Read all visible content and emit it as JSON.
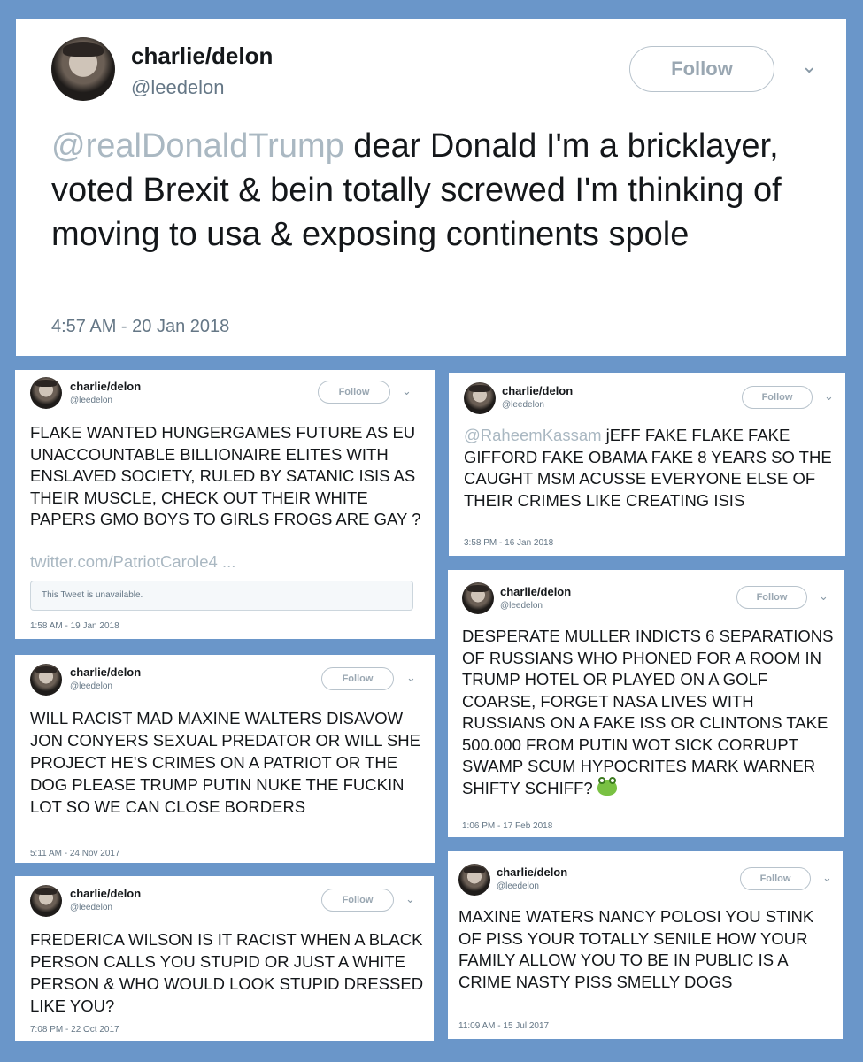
{
  "tweets": [
    {
      "user": {
        "name": "charlie/delon",
        "handle": "@leedelon"
      },
      "follow_label": "Follow",
      "mention": "@realDonaldTrump",
      "text": " dear Donald I'm a bricklayer, voted Brexit & bein totally screwed I'm thinking of moving to usa & exposing continents spole",
      "time": "4:57 AM - 20 Jan 2018"
    },
    {
      "user": {
        "name": "charlie/delon",
        "handle": "@leedelon"
      },
      "follow_label": "Follow",
      "text": "FLAKE WANTED HUNGERGAMES FUTURE AS EU UNACCOUNTABLE BILLIONAIRE ELITES WITH ENSLAVED SOCIETY, RULED BY SATANIC ISIS AS THEIR MUSCLE, CHECK OUT THEIR WHITE PAPERS GMO BOYS TO GIRLS FROGS ARE GAY ?",
      "link": "twitter.com/PatriotCarole4 ...",
      "unavailable": "This Tweet is unavailable.",
      "time": "1:58 AM - 19 Jan 2018"
    },
    {
      "user": {
        "name": "charlie/delon",
        "handle": "@leedelon"
      },
      "follow_label": "Follow",
      "mention": "@RaheemKassam",
      "text": " jEFF FAKE FLAKE FAKE GIFFORD FAKE OBAMA FAKE 8 YEARS SO THE CAUGHT MSM ACUSSE EVERYONE ELSE OF THEIR CRIMES LIKE CREATING ISIS",
      "time": "3:58 PM - 16 Jan 2018"
    },
    {
      "user": {
        "name": "charlie/delon",
        "handle": "@leedelon"
      },
      "follow_label": "Follow",
      "text": "DESPERATE MULLER INDICTS 6 SEPARATIONS OF RUSSIANS WHO PHONED FOR A ROOM IN TRUMP HOTEL OR PLAYED ON A GOLF COARSE, FORGET NASA LIVES WITH RUSSIANS ON A FAKE ISS OR CLINTONS TAKE 500.000 FROM PUTIN WOT SICK CORRUPT SWAMP SCUM HYPOCRITES MARK WARNER SHIFTY SCHIFF?",
      "emoji": "frog-emoji",
      "time": "1:06 PM - 17 Feb 2018"
    },
    {
      "user": {
        "name": "charlie/delon",
        "handle": "@leedelon"
      },
      "follow_label": "Follow",
      "text": "WILL RACIST MAD MAXINE WALTERS DISAVOW JON CONYERS SEXUAL PREDATOR OR WILL SHE PROJECT HE'S CRIMES ON A PATRIOT OR THE DOG PLEASE TRUMP PUTIN NUKE THE FUCKIN LOT SO WE CAN CLOSE BORDERS",
      "time": "5:11 AM - 24 Nov 2017"
    },
    {
      "user": {
        "name": "charlie/delon",
        "handle": "@leedelon"
      },
      "follow_label": "Follow",
      "text": "MAXINE WATERS NANCY POLOSI YOU STINK OF PISS YOUR TOTALLY SENILE HOW YOUR FAMILY ALLOW YOU TO BE IN PUBLIC IS A CRIME NASTY PISS SMELLY DOGS",
      "time": "11:09 AM - 15 Jul 2017"
    },
    {
      "user": {
        "name": "charlie/delon",
        "handle": "@leedelon"
      },
      "follow_label": "Follow",
      "text": "FREDERICA WILSON IS IT RACIST WHEN A BLACK PERSON CALLS YOU STUPID OR JUST A WHITE PERSON & WHO WOULD LOOK STUPID DRESSED LIKE YOU?",
      "time": "7:08 PM - 22 Oct 2017"
    }
  ],
  "colors": {
    "background": "#6a96c9",
    "mention": "#aab8c2",
    "card": "#ffffff"
  },
  "icons": {
    "dropdown": "chevron-down-icon",
    "avatar": "avatar"
  }
}
